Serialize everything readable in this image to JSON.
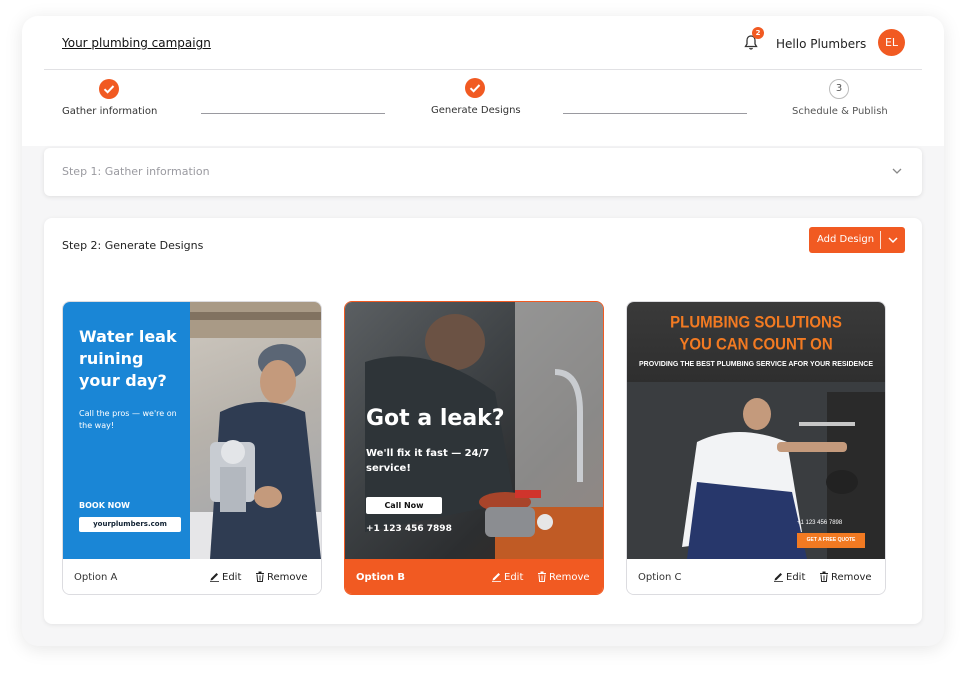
{
  "header": {
    "campaign_title": "Your plumbing campaign",
    "notification_count": "2",
    "greeting": "Hello Plumbers",
    "avatar_initials": "EL"
  },
  "stepper": {
    "steps": [
      {
        "label": "Gather information",
        "status": "complete",
        "icon": "check-icon"
      },
      {
        "label": "Generate Designs",
        "status": "complete",
        "icon": "check-icon"
      },
      {
        "label": "Schedule & Publish",
        "status": "pending",
        "number": "3"
      }
    ]
  },
  "panel1": {
    "title": "Step 1: Gather information",
    "icon": "chevron-down-icon"
  },
  "panel2": {
    "title": "Step 2: Generate Designs",
    "add_button_label": "Add Design"
  },
  "cards": [
    {
      "option_label": "Option A",
      "edit_label": "Edit",
      "remove_label": "Remove",
      "selected": false,
      "design": {
        "headline": "Water leak ruining your day?",
        "subtext": "Call the pros — we're on the way!",
        "cta": "BOOK NOW",
        "url": "yourplumbers.com"
      }
    },
    {
      "option_label": "Option B",
      "edit_label": "Edit",
      "remove_label": "Remove",
      "selected": true,
      "design": {
        "headline": "Got a leak?",
        "subtext": "We'll fix it fast — 24/7 service!",
        "cta": "Call Now",
        "phone": "+1 123 456 7898"
      }
    },
    {
      "option_label": "Option C",
      "edit_label": "Edit",
      "remove_label": "Remove",
      "selected": false,
      "design": {
        "headline_line1": "PLUMBING SOLUTIONS",
        "headline_line2": "YOU CAN COUNT ON",
        "subtext": "PROVIDING THE BEST PLUMBING SERVICE AFOR YOUR RESIDENCE",
        "phone": "+1 123 456 7898",
        "cta": "GET A FREE QUOTE"
      }
    }
  ],
  "colors": {
    "accent": "#f15a22",
    "blue": "#1a86d6",
    "c_orange": "#f27a22"
  }
}
